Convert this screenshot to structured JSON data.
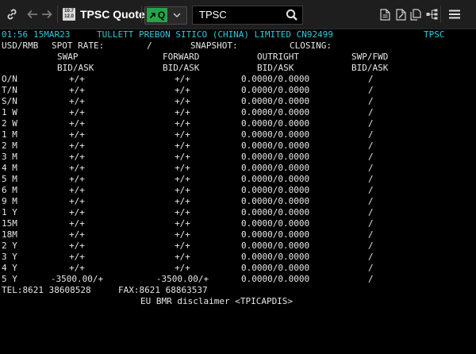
{
  "toolbar": {
    "app_badge_top": "10.7",
    "app_badge_bottom": "12.0",
    "title": "TPSC Quote",
    "q_label": "Q",
    "search_value": "TPSC"
  },
  "colors": {
    "background": "#000000",
    "toolbar": "#1e1e1e",
    "header_text": "#2ec8e0",
    "body_text": "#e6e6e6",
    "q_button": "#23a64a"
  },
  "icons": [
    "link-icon",
    "back-arrow-icon",
    "forward-arrow-icon",
    "app-badge-icon",
    "arrow-up-right-icon",
    "chevron-down-icon",
    "search-icon",
    "document-icon",
    "document-edit-icon",
    "document-copy-icon",
    "tree-icon",
    "menu-icon"
  ],
  "quote": {
    "header": {
      "time": "01:56",
      "date": "15MAR23",
      "source": "TULLETT PREBON SITICO (CHINA) LIMITED CN92499",
      "code": "TPSC"
    },
    "pair": "USD/RMB",
    "spot_rate_label": "SPOT RATE:",
    "spot_rate_value": "/",
    "snapshot_label": "SNAPSHOT:",
    "closing_label": "CLOSING:",
    "columns": [
      "SWAP",
      "FORWARD",
      "OUTRIGHT",
      "SWP/FWD"
    ],
    "subheaders": [
      "BID/ASK",
      "BID/ASK",
      "BID/ASK",
      "BID/ASK"
    ],
    "rows": [
      {
        "tenor": "O/N",
        "swap": "+/+",
        "forward": "+/+",
        "outright": "0.0000/0.0000",
        "swp_fwd": "/"
      },
      {
        "tenor": "T/N",
        "swap": "+/+",
        "forward": "+/+",
        "outright": "0.0000/0.0000",
        "swp_fwd": "/"
      },
      {
        "tenor": "S/N",
        "swap": "+/+",
        "forward": "+/+",
        "outright": "0.0000/0.0000",
        "swp_fwd": "/"
      },
      {
        "tenor": "1 W",
        "swap": "+/+",
        "forward": "+/+",
        "outright": "0.0000/0.0000",
        "swp_fwd": "/"
      },
      {
        "tenor": "2 W",
        "swap": "+/+",
        "forward": "+/+",
        "outright": "0.0000/0.0000",
        "swp_fwd": "/"
      },
      {
        "tenor": "1 M",
        "swap": "+/+",
        "forward": "+/+",
        "outright": "0.0000/0.0000",
        "swp_fwd": "/"
      },
      {
        "tenor": "2 M",
        "swap": "+/+",
        "forward": "+/+",
        "outright": "0.0000/0.0000",
        "swp_fwd": "/"
      },
      {
        "tenor": "3 M",
        "swap": "+/+",
        "forward": "+/+",
        "outright": "0.0000/0.0000",
        "swp_fwd": "/"
      },
      {
        "tenor": "4 M",
        "swap": "+/+",
        "forward": "+/+",
        "outright": "0.0000/0.0000",
        "swp_fwd": "/"
      },
      {
        "tenor": "5 M",
        "swap": "+/+",
        "forward": "+/+",
        "outright": "0.0000/0.0000",
        "swp_fwd": "/"
      },
      {
        "tenor": "6 M",
        "swap": "+/+",
        "forward": "+/+",
        "outright": "0.0000/0.0000",
        "swp_fwd": "/"
      },
      {
        "tenor": "9 M",
        "swap": "+/+",
        "forward": "+/+",
        "outright": "0.0000/0.0000",
        "swp_fwd": "/"
      },
      {
        "tenor": "1 Y",
        "swap": "+/+",
        "forward": "+/+",
        "outright": "0.0000/0.0000",
        "swp_fwd": "/"
      },
      {
        "tenor": "15M",
        "swap": "+/+",
        "forward": "+/+",
        "outright": "0.0000/0.0000",
        "swp_fwd": "/"
      },
      {
        "tenor": "18M",
        "swap": "+/+",
        "forward": "+/+",
        "outright": "0.0000/0.0000",
        "swp_fwd": "/"
      },
      {
        "tenor": "2 Y",
        "swap": "+/+",
        "forward": "+/+",
        "outright": "0.0000/0.0000",
        "swp_fwd": "/"
      },
      {
        "tenor": "3 Y",
        "swap": "+/+",
        "forward": "+/+",
        "outright": "0.0000/0.0000",
        "swp_fwd": "/"
      },
      {
        "tenor": "4 Y",
        "swap": "+/+",
        "forward": "+/+",
        "outright": "0.0000/0.0000",
        "swp_fwd": "/"
      },
      {
        "tenor": "5 Y",
        "swap": "-3500.00/+",
        "forward": "-3500.00/+",
        "outright": "0.0000/0.0000",
        "swp_fwd": "/"
      }
    ],
    "tel": "TEL:8621 38608528",
    "fax": "FAX:8621 68863537",
    "disclaimer": "EU BMR disclaimer <TPICAPDIS>"
  }
}
